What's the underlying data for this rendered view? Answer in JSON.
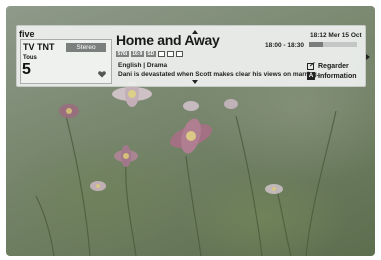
{
  "channel": {
    "brand": "five",
    "name": "TV TNT",
    "audio_badge": "Stereo",
    "category": "Tous",
    "number": "5"
  },
  "programme": {
    "title": "Home and Away",
    "tags": [
      "576i",
      "16:9",
      "SD"
    ],
    "genre": "English  |  Drama",
    "synopsis": "Dani is devastated when Scott makes clear his views on marriag...",
    "time_slot": "18:00 - 18:30",
    "progress_percent": 30
  },
  "status": {
    "clock": "18:12 Mer 15 Oct"
  },
  "actions": {
    "watch_label": "Regarder",
    "info_key": "A",
    "info_label": "Information"
  },
  "icons": {
    "favorite": "heart-icon",
    "subtitles": "subtitles-icon",
    "ad": "audio-description-icon",
    "watch": "record-icon"
  }
}
